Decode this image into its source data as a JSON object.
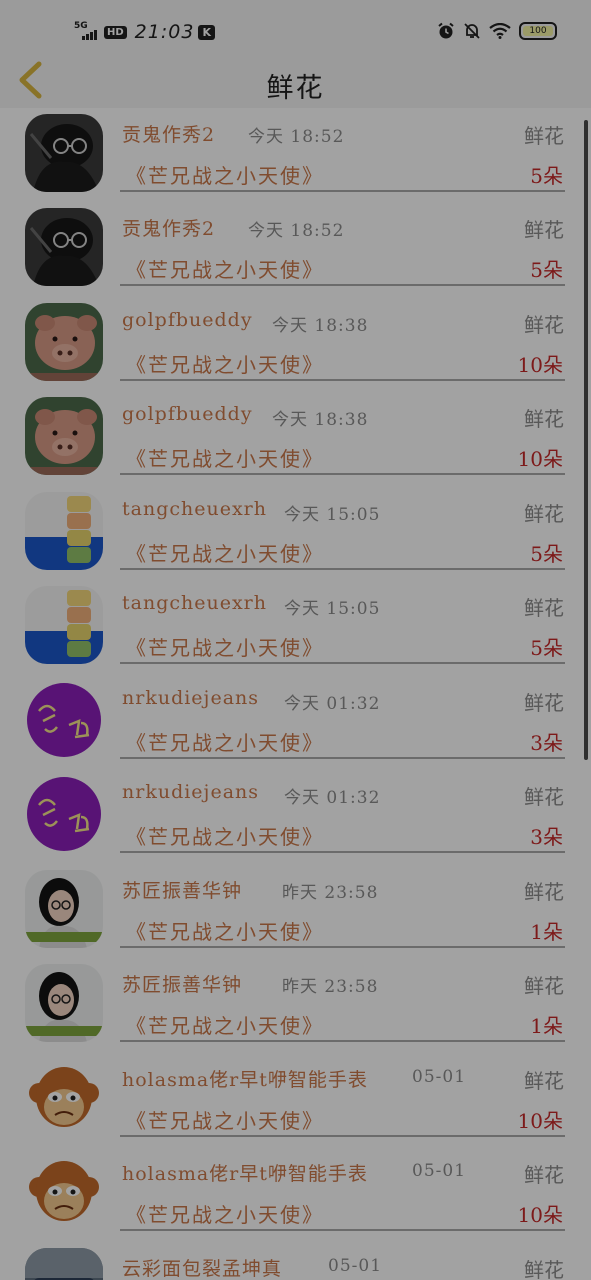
{
  "status_bar": {
    "network": "5G",
    "hd": "HD",
    "time": "21:03",
    "k_badge": "K",
    "battery": "100",
    "icons": [
      "alarm-icon",
      "bell-off-icon",
      "wifi-icon",
      "battery-icon"
    ]
  },
  "header": {
    "back_icon": "chevron-left-icon",
    "title": "鲜花"
  },
  "items": [
    {
      "name": "贡鬼作秀2",
      "time": "今天 18:52",
      "gift": "鲜花",
      "movie": "《芒兄战之小天使》",
      "qty": "5朵",
      "avatar": "dark-photo"
    },
    {
      "name": "贡鬼作秀2",
      "time": "今天 18:52",
      "gift": "鲜花",
      "movie": "《芒兄战之小天使》",
      "qty": "5朵",
      "avatar": "dark-photo"
    },
    {
      "name": "golpfbueddy",
      "time": "今天 18:38",
      "gift": "鲜花",
      "movie": "《芒兄战之小天使》",
      "qty": "10朵",
      "avatar": "pig-face"
    },
    {
      "name": "golpfbueddy",
      "time": "今天 18:38",
      "gift": "鲜花",
      "movie": "《芒兄战之小天使》",
      "qty": "10朵",
      "avatar": "pig-face"
    },
    {
      "name": "tangcheuexrh",
      "time": "今天 15:05",
      "gift": "鲜花",
      "movie": "《芒兄战之小天使》",
      "qty": "5朵",
      "avatar": "toy-stack"
    },
    {
      "name": "tangcheuexrh",
      "time": "今天 15:05",
      "gift": "鲜花",
      "movie": "《芒兄战之小天使》",
      "qty": "5朵",
      "avatar": "toy-stack"
    },
    {
      "name": "nrkudiejeans",
      "time": "今天 01:32",
      "gift": "鲜花",
      "movie": "《芒兄战之小天使》",
      "qty": "3朵",
      "avatar": "purple-circle"
    },
    {
      "name": "nrkudiejeans",
      "time": "今天 01:32",
      "gift": "鲜花",
      "movie": "《芒兄战之小天使》",
      "qty": "3朵",
      "avatar": "purple-circle"
    },
    {
      "name": "苏匠振善华钟",
      "time": "昨天 23:58",
      "gift": "鲜花",
      "movie": "《芒兄战之小天使》",
      "qty": "1朵",
      "avatar": "girl-glasses"
    },
    {
      "name": "苏匠振善华钟",
      "time": "昨天 23:58",
      "gift": "鲜花",
      "movie": "《芒兄战之小天使》",
      "qty": "1朵",
      "avatar": "girl-glasses"
    },
    {
      "name": "holasma佬r早t咿智能手表",
      "time": "05-01",
      "gift": "鲜花",
      "movie": "《芒兄战之小天使》",
      "qty": "10朵",
      "avatar": "monkey-face"
    },
    {
      "name": "holasma佬r早t咿智能手表",
      "time": "05-01",
      "gift": "鲜花",
      "movie": "《芒兄战之小天使》",
      "qty": "10朵",
      "avatar": "monkey-face"
    },
    {
      "name": "云彩面包裂孟坤真",
      "time": "05-01",
      "gift": "鲜花",
      "movie": "",
      "qty": "",
      "avatar": "car-scene"
    }
  ]
}
